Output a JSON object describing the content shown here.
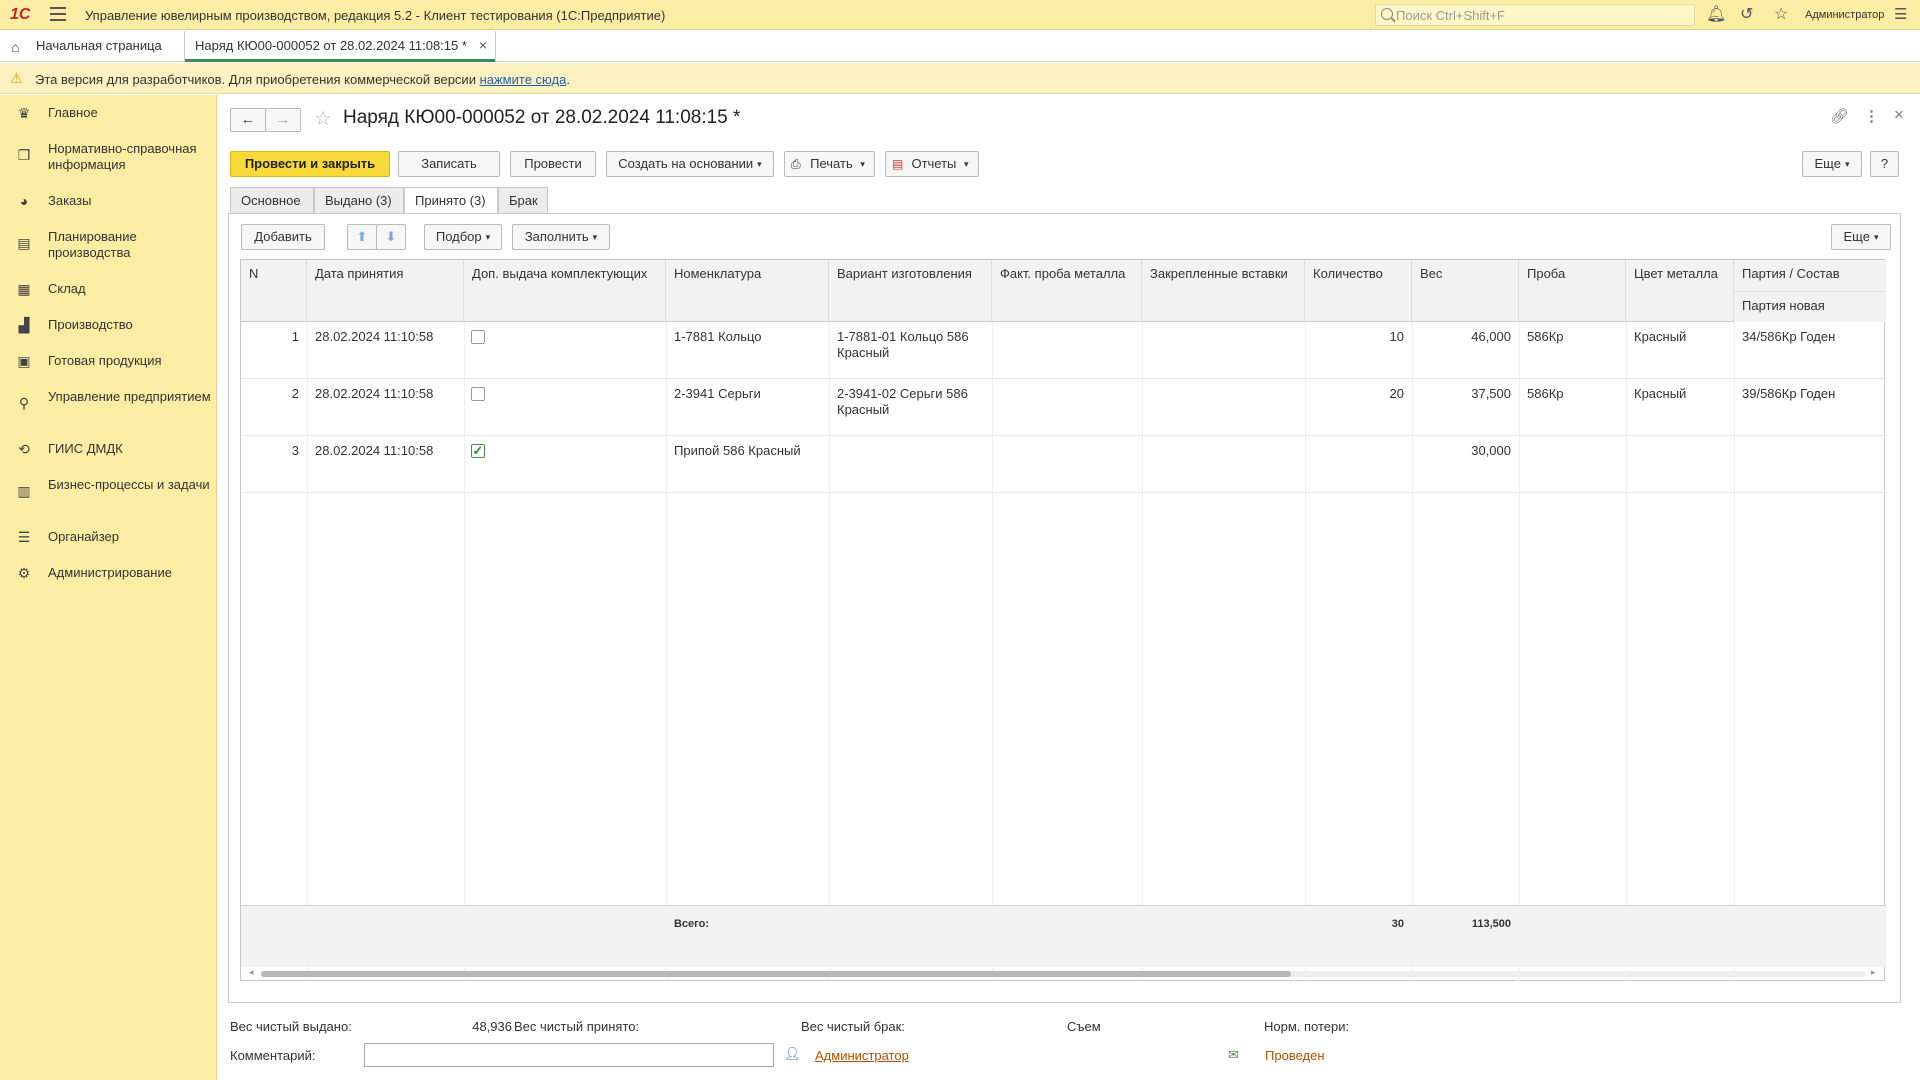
{
  "topbar": {
    "logo": "1С",
    "title": "Управление ювелирным производством, редакция 5.2  - Клиент тестирования (1С:Предприятие)",
    "search_placeholder": "Поиск Ctrl+Shift+F",
    "user": "Администратор"
  },
  "tabs": {
    "home": "Начальная страница",
    "document": "Наряд КЮ00-000052 от 28.02.2024 11:08:15 *"
  },
  "warning": {
    "text": "Эта версия для разработчиков. Для приобретения коммерческой версии ",
    "link": "нажмите сюда",
    "suffix": "."
  },
  "sidebar": {
    "items": [
      {
        "label": "Главное",
        "icon": "crown-icon"
      },
      {
        "label": "Нормативно-справочная информация",
        "icon": "book-icon"
      },
      {
        "label": "Заказы",
        "icon": "pie-icon"
      },
      {
        "label": "Планирование производства",
        "icon": "clipboard-icon"
      },
      {
        "label": "Склад",
        "icon": "grid-icon"
      },
      {
        "label": "Производство",
        "icon": "factory-icon"
      },
      {
        "label": "Готовая продукция",
        "icon": "bag-icon"
      },
      {
        "label": "Управление предприятием",
        "icon": "org-icon"
      },
      {
        "label": "ГИИС ДМДК",
        "icon": "refresh-search-icon"
      },
      {
        "label": "Бизнес-процессы и задачи",
        "icon": "tasks-icon"
      },
      {
        "label": "Органайзер",
        "icon": "list-icon"
      },
      {
        "label": "Администрирование",
        "icon": "gear-icon"
      }
    ]
  },
  "document": {
    "title": "Наряд КЮ00-000052 от 28.02.2024 11:08:15 *",
    "toolbar": {
      "post_close": "Провести и закрыть",
      "save": "Записать",
      "post": "Провести",
      "create_based": "Создать на основании",
      "print": "Печать",
      "reports": "Отчеты",
      "more": "Еще",
      "help": "?"
    },
    "form_tabs": [
      "Основное",
      "Выдано (3)",
      "Принято (3)",
      "Брак"
    ],
    "table_toolbar": {
      "add": "Добавить",
      "pick": "Подбор",
      "fill": "Заполнить",
      "more": "Еще"
    },
    "columns": [
      "N",
      "Дата принятия",
      "Доп. выдача комплектующих",
      "Номенклатура",
      "Вариант изготовления",
      "Факт. проба металла",
      "Закрепленные вставки",
      "Количество",
      "Вес",
      "Проба",
      "Цвет металла",
      "Партия / Состав"
    ],
    "subcolumn": "Партия новая",
    "rows": [
      {
        "n": "1",
        "date": "28.02.2024 11:10:58",
        "extra": false,
        "nomenclature": "1-7881 Кольцо",
        "variant": "1-7881-01 Кольцо 586 Красный",
        "fact_proba": "",
        "inserts": "",
        "qty": "10",
        "weight": "46,000",
        "proba": "586Кр",
        "color": "Красный",
        "batch": "34/586Кр Годен"
      },
      {
        "n": "2",
        "date": "28.02.2024 11:10:58",
        "extra": false,
        "nomenclature": "2-3941 Серьги",
        "variant": "2-3941-02 Серьги 586 Красный",
        "fact_proba": "",
        "inserts": "",
        "qty": "20",
        "weight": "37,500",
        "proba": "586Кр",
        "color": "Красный",
        "batch": "39/586Кр Годен"
      },
      {
        "n": "3",
        "date": "28.02.2024 11:10:58",
        "extra": true,
        "nomenclature": "Припой 586 Красный",
        "variant": "",
        "fact_proba": "",
        "inserts": "",
        "qty": "",
        "weight": "30,000",
        "proba": "",
        "color": "",
        "batch": ""
      }
    ],
    "footer": {
      "total_label": "Всего:",
      "qty_total": "30",
      "weight_total": "113,500"
    },
    "bottom": {
      "net_issued_label": "Вес чистый выдано:",
      "net_issued_value": "48,936",
      "net_accepted_label": "Вес чистый принято:",
      "net_defect_label": "Вес чистый брак:",
      "removal_label": "Съем",
      "norm_loss_label": "Норм. потери:",
      "comment_label": "Комментарий:",
      "author": "Администратор",
      "status": "Проведен"
    }
  },
  "colors": {
    "accent": "#fbeda4",
    "primary_button": "#f8d93a",
    "link": "#b35000",
    "tab_underline": "#3b8b5a"
  }
}
